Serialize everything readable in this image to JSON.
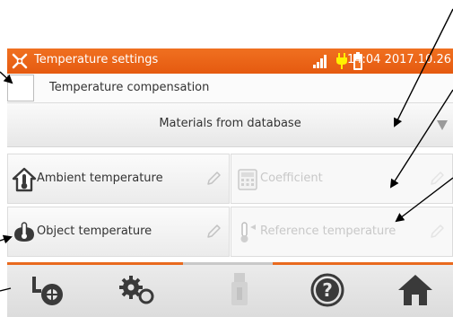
{
  "statusbar": {
    "title": "Temperature settings",
    "time": "14:04 2017.10.26"
  },
  "compensation": {
    "label": "Temperature compensation",
    "checked": false
  },
  "materials": {
    "selected": "Materials from database"
  },
  "tiles": [
    {
      "label": "Ambient temperature",
      "icon": "house-thermometer-icon",
      "enabled": true
    },
    {
      "label": "Coefficient",
      "icon": "calculator-icon",
      "enabled": false
    },
    {
      "label": "Object temperature",
      "icon": "object-thermometer-icon",
      "enabled": true
    },
    {
      "label": "Reference temperature",
      "icon": "reference-thermometer-icon",
      "enabled": false
    }
  ],
  "toolbar": [
    {
      "icon": "measurement-mode-icon",
      "enabled": true
    },
    {
      "icon": "settings-gears-icon",
      "enabled": true
    },
    {
      "icon": "usb-memory-icon",
      "enabled": false
    },
    {
      "icon": "help-icon",
      "enabled": true
    },
    {
      "icon": "home-icon",
      "enabled": true
    }
  ],
  "colors": {
    "accent": "#e96a1e",
    "text": "#333333",
    "disabled_text": "#c8c8c8"
  }
}
